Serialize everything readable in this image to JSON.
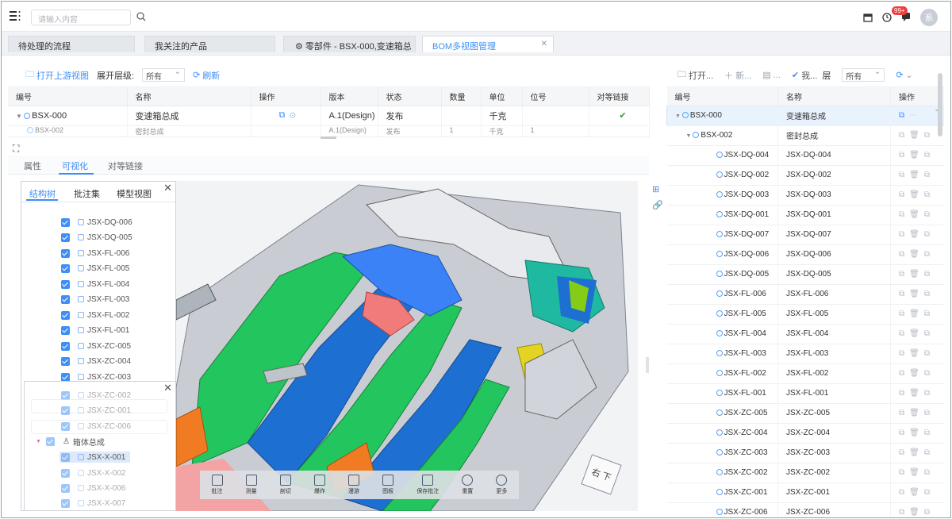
{
  "topbar": {
    "search_placeholder": "请输入内容",
    "badge": "99+",
    "avatar": "系"
  },
  "tabs": [
    {
      "label": "待处理的流程",
      "active": false
    },
    {
      "label": "我关注的产品",
      "active": false
    },
    {
      "label": "零部件 - BSX-000,变速箱总",
      "active": false
    },
    {
      "label": "BOM多视图管理",
      "active": true
    }
  ],
  "left": {
    "toolbar": {
      "open_upstream": "打开上游视图",
      "expand_level_label": "展开层级:",
      "expand_level_value": "所有",
      "refresh": "刷新"
    },
    "columns": [
      "编号",
      "名称",
      "操作",
      "版本",
      "状态",
      "数量",
      "单位",
      "位号",
      "对等链接"
    ],
    "rows": [
      {
        "code": "BSX-000",
        "name": "变速箱总成",
        "version": "A.1(Design)",
        "state": "发布",
        "qty": "",
        "unit": "千克",
        "pos": "",
        "link": "✔"
      },
      {
        "code": "BSX-002",
        "name": "密封总成",
        "version": "A.1(Design)",
        "state": "发布",
        "qty": "1",
        "unit": "千克",
        "pos": "1",
        "link": ""
      }
    ],
    "subtabs": [
      "属性",
      "可视化",
      "对等链接"
    ],
    "tree_tabs": [
      "结构树",
      "批注集",
      "模型视图"
    ],
    "tree_items": [
      "JSX-DQ-006",
      "JSX-DQ-005",
      "JSX-FL-006",
      "JSX-FL-005",
      "JSX-FL-004",
      "JSX-FL-003",
      "JSX-FL-002",
      "JSX-FL-001",
      "JSX-ZC-005",
      "JSX-ZC-004",
      "JSX-ZC-003"
    ],
    "popup": {
      "overlap_items": [
        "JSX-ZC-002",
        "JSX-ZC-001",
        "JSX-ZC-006"
      ],
      "group": "箱体总成",
      "group_items": [
        "JSX-X-001",
        "JSX-X-002",
        "JSX-X-006",
        "JSX-X-007"
      ]
    },
    "viewer_tools": [
      "批注",
      "测量",
      "剖切",
      "爆炸",
      "漫游",
      "图板",
      "保存批注",
      "重置",
      "更多"
    ],
    "navcube": "右 下"
  },
  "right": {
    "toolbar": {
      "open": "打开...",
      "new": "新...",
      "edit": "...",
      "check": "我...",
      "level_label": "层",
      "level_value": "所有"
    },
    "columns": [
      "编号",
      "名称",
      "操作"
    ],
    "rows": [
      {
        "code": "BSX-000",
        "name": "变速箱总成",
        "level": 0
      },
      {
        "code": "BSX-002",
        "name": "密封总成",
        "level": 1
      },
      {
        "code": "JSX-DQ-004",
        "name": "JSX-DQ-004",
        "level": 2
      },
      {
        "code": "JSX-DQ-002",
        "name": "JSX-DQ-002",
        "level": 2
      },
      {
        "code": "JSX-DQ-003",
        "name": "JSX-DQ-003",
        "level": 2
      },
      {
        "code": "JSX-DQ-001",
        "name": "JSX-DQ-001",
        "level": 2
      },
      {
        "code": "JSX-DQ-007",
        "name": "JSX-DQ-007",
        "level": 2
      },
      {
        "code": "JSX-DQ-006",
        "name": "JSX-DQ-006",
        "level": 2
      },
      {
        "code": "JSX-DQ-005",
        "name": "JSX-DQ-005",
        "level": 2
      },
      {
        "code": "JSX-FL-006",
        "name": "JSX-FL-006",
        "level": 2
      },
      {
        "code": "JSX-FL-005",
        "name": "JSX-FL-005",
        "level": 2
      },
      {
        "code": "JSX-FL-004",
        "name": "JSX-FL-004",
        "level": 2
      },
      {
        "code": "JSX-FL-003",
        "name": "JSX-FL-003",
        "level": 2
      },
      {
        "code": "JSX-FL-002",
        "name": "JSX-FL-002",
        "level": 2
      },
      {
        "code": "JSX-FL-001",
        "name": "JSX-FL-001",
        "level": 2
      },
      {
        "code": "JSX-ZC-005",
        "name": "JSX-ZC-005",
        "level": 2
      },
      {
        "code": "JSX-ZC-004",
        "name": "JSX-ZC-004",
        "level": 2
      },
      {
        "code": "JSX-ZC-003",
        "name": "JSX-ZC-003",
        "level": 2
      },
      {
        "code": "JSX-ZC-002",
        "name": "JSX-ZC-002",
        "level": 2
      },
      {
        "code": "JSX-ZC-001",
        "name": "JSX-ZC-001",
        "level": 2
      },
      {
        "code": "JSX-ZC-006",
        "name": "JSX-ZC-006",
        "level": 2
      }
    ]
  },
  "colors": {
    "accent": "#3e8ef7",
    "badge": "#f03e3e"
  }
}
